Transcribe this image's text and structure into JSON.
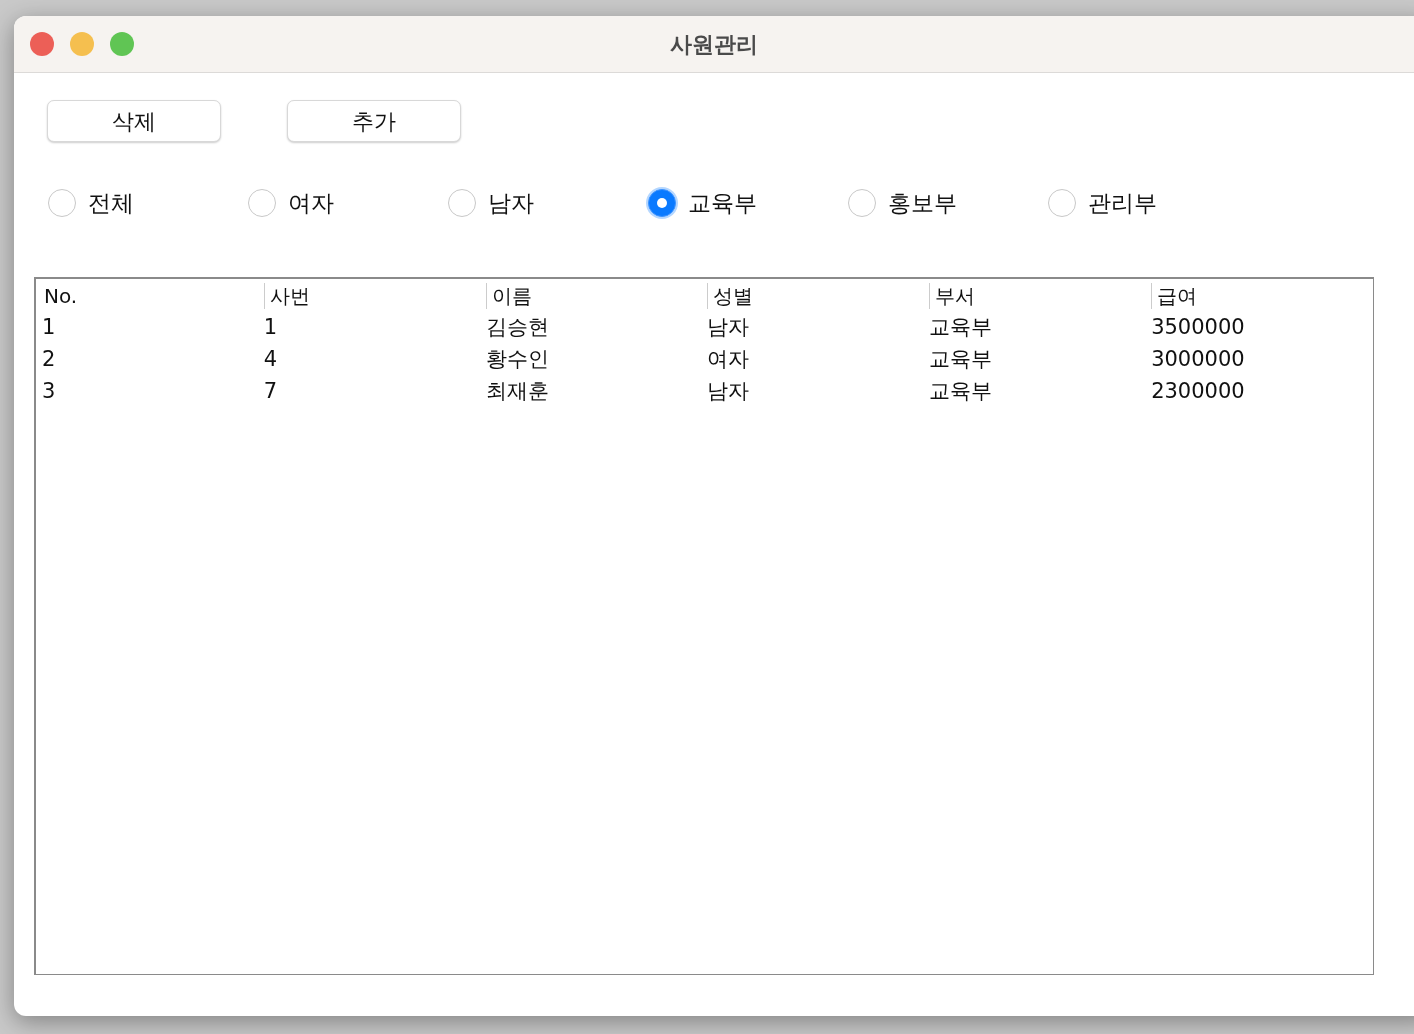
{
  "window": {
    "title": "사원관리"
  },
  "buttons": [
    "삭제",
    "추가"
  ],
  "filters": [
    {
      "label": "전체",
      "selected": false
    },
    {
      "label": "여자",
      "selected": false
    },
    {
      "label": "남자",
      "selected": false
    },
    {
      "label": "교육부",
      "selected": true
    },
    {
      "label": "홍보부",
      "selected": false
    },
    {
      "label": "관리부",
      "selected": false
    }
  ],
  "table": {
    "columns": [
      "No.",
      "사번",
      "이름",
      "성별",
      "부서",
      "급여"
    ],
    "rows": [
      [
        "1",
        "1",
        "김승현",
        "남자",
        "교육부",
        "3500000"
      ],
      [
        "2",
        "4",
        "황수인",
        "여자",
        "교육부",
        "3000000"
      ],
      [
        "3",
        "7",
        "최재훈",
        "남자",
        "교육부",
        "2300000"
      ]
    ]
  }
}
